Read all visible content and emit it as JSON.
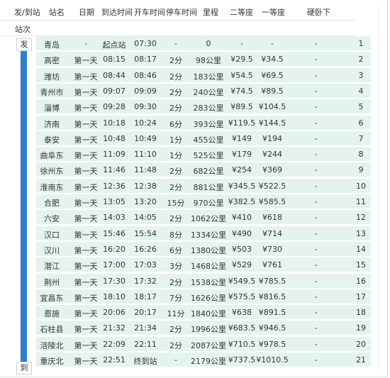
{
  "header": {
    "station": "发/到站",
    "name": "站名",
    "date": "日期",
    "arrive": "到达时间",
    "depart": "开车时间",
    "stop": "停车时间",
    "distance": "里程",
    "second": "二等座",
    "first": "一等座",
    "sleeper": "硬卧下"
  },
  "subheader": "站次",
  "tags": {
    "start": "发",
    "end": "到"
  },
  "rows": [
    {
      "station": "青岛",
      "day": "-",
      "arrive": "起点站",
      "depart": "07:30",
      "stop": "-",
      "km": "0",
      "second": "-",
      "first": "-",
      "sleeper": "-",
      "no": "1"
    },
    {
      "station": "高密",
      "day": "第一天",
      "arrive": "08:15",
      "depart": "08:17",
      "stop": "2分",
      "km": "98公里",
      "second": "¥29.5",
      "first": "¥34.5",
      "sleeper": "-",
      "no": "2"
    },
    {
      "station": "潍坊",
      "day": "第一天",
      "arrive": "08:44",
      "depart": "08:46",
      "stop": "2分",
      "km": "183公里",
      "second": "¥54.5",
      "first": "¥69.5",
      "sleeper": "-",
      "no": "3"
    },
    {
      "station": "青州市",
      "day": "第一天",
      "arrive": "09:07",
      "depart": "09:09",
      "stop": "2分",
      "km": "240公里",
      "second": "¥74.5",
      "first": "¥89.5",
      "sleeper": "-",
      "no": "4"
    },
    {
      "station": "淄博",
      "day": "第一天",
      "arrive": "09:28",
      "depart": "09:30",
      "stop": "2分",
      "km": "283公里",
      "second": "¥89.5",
      "first": "¥104.5",
      "sleeper": "-",
      "no": "5"
    },
    {
      "station": "济南",
      "day": "第一天",
      "arrive": "10:18",
      "depart": "10:24",
      "stop": "6分",
      "km": "393公里",
      "second": "¥119.5",
      "first": "¥144.5",
      "sleeper": "-",
      "no": "6"
    },
    {
      "station": "泰安",
      "day": "第一天",
      "arrive": "10:48",
      "depart": "10:49",
      "stop": "1分",
      "km": "455公里",
      "second": "¥149",
      "first": "¥194",
      "sleeper": "-",
      "no": "7"
    },
    {
      "station": "曲阜东",
      "day": "第一天",
      "arrive": "11:09",
      "depart": "11:10",
      "stop": "1分",
      "km": "525公里",
      "second": "¥179",
      "first": "¥244",
      "sleeper": "-",
      "no": "8"
    },
    {
      "station": "徐州东",
      "day": "第一天",
      "arrive": "11:46",
      "depart": "11:48",
      "stop": "2分",
      "km": "682公里",
      "second": "¥254",
      "first": "¥369",
      "sleeper": "-",
      "no": "9"
    },
    {
      "station": "淮南东",
      "day": "第一天",
      "arrive": "12:36",
      "depart": "12:38",
      "stop": "2分",
      "km": "881公里",
      "second": "¥345.5",
      "first": "¥522.5",
      "sleeper": "-",
      "no": "10"
    },
    {
      "station": "合肥",
      "day": "第一天",
      "arrive": "13:05",
      "depart": "13:20",
      "stop": "15分",
      "km": "970公里",
      "second": "¥382.5",
      "first": "¥585.5",
      "sleeper": "-",
      "no": "11"
    },
    {
      "station": "六安",
      "day": "第一天",
      "arrive": "14:03",
      "depart": "14:05",
      "stop": "2分",
      "km": "1062公里",
      "second": "¥410",
      "first": "¥618",
      "sleeper": "-",
      "no": "12"
    },
    {
      "station": "汉口",
      "day": "第一天",
      "arrive": "15:46",
      "depart": "15:54",
      "stop": "8分",
      "km": "1334公里",
      "second": "¥490",
      "first": "¥714",
      "sleeper": "-",
      "no": "13"
    },
    {
      "station": "汉川",
      "day": "第一天",
      "arrive": "16:20",
      "depart": "16:26",
      "stop": "6分",
      "km": "1380公里",
      "second": "¥503",
      "first": "¥730",
      "sleeper": "-",
      "no": "14"
    },
    {
      "station": "潜江",
      "day": "第一天",
      "arrive": "17:00",
      "depart": "17:03",
      "stop": "3分",
      "km": "1468公里",
      "second": "¥529",
      "first": "¥761",
      "sleeper": "-",
      "no": "15"
    },
    {
      "station": "荆州",
      "day": "第一天",
      "arrive": "17:30",
      "depart": "17:32",
      "stop": "2分",
      "km": "1538公里",
      "second": "¥549.5",
      "first": "¥785.5",
      "sleeper": "-",
      "no": "16"
    },
    {
      "station": "宜昌东",
      "day": "第一天",
      "arrive": "18:10",
      "depart": "18:17",
      "stop": "7分",
      "km": "1626公里",
      "second": "¥575.5",
      "first": "¥816.5",
      "sleeper": "-",
      "no": "17"
    },
    {
      "station": "恩施",
      "day": "第一天",
      "arrive": "20:06",
      "depart": "20:17",
      "stop": "11分",
      "km": "1840公里",
      "second": "¥638",
      "first": "¥891.5",
      "sleeper": "-",
      "no": "18"
    },
    {
      "station": "石柱县",
      "day": "第一天",
      "arrive": "21:32",
      "depart": "21:34",
      "stop": "2分",
      "km": "1996公里",
      "second": "¥683.5",
      "first": "¥946.5",
      "sleeper": "-",
      "no": "19"
    },
    {
      "station": "涪陵北",
      "day": "第一天",
      "arrive": "22:09",
      "depart": "22:11",
      "stop": "2分",
      "km": "2087公里",
      "second": "¥710.5",
      "first": "¥978.5",
      "sleeper": "-",
      "no": "20"
    },
    {
      "station": "重庆北",
      "day": "第一天",
      "arrive": "22:51",
      "depart": "终到站",
      "stop": "-",
      "km": "2179公里",
      "second": "¥737.5",
      "first": "¥1010.5",
      "sleeper": "-",
      "no": "21"
    }
  ],
  "colors": {
    "row_bg": "#e5f3ef",
    "rail": "#2f7fd0"
  }
}
